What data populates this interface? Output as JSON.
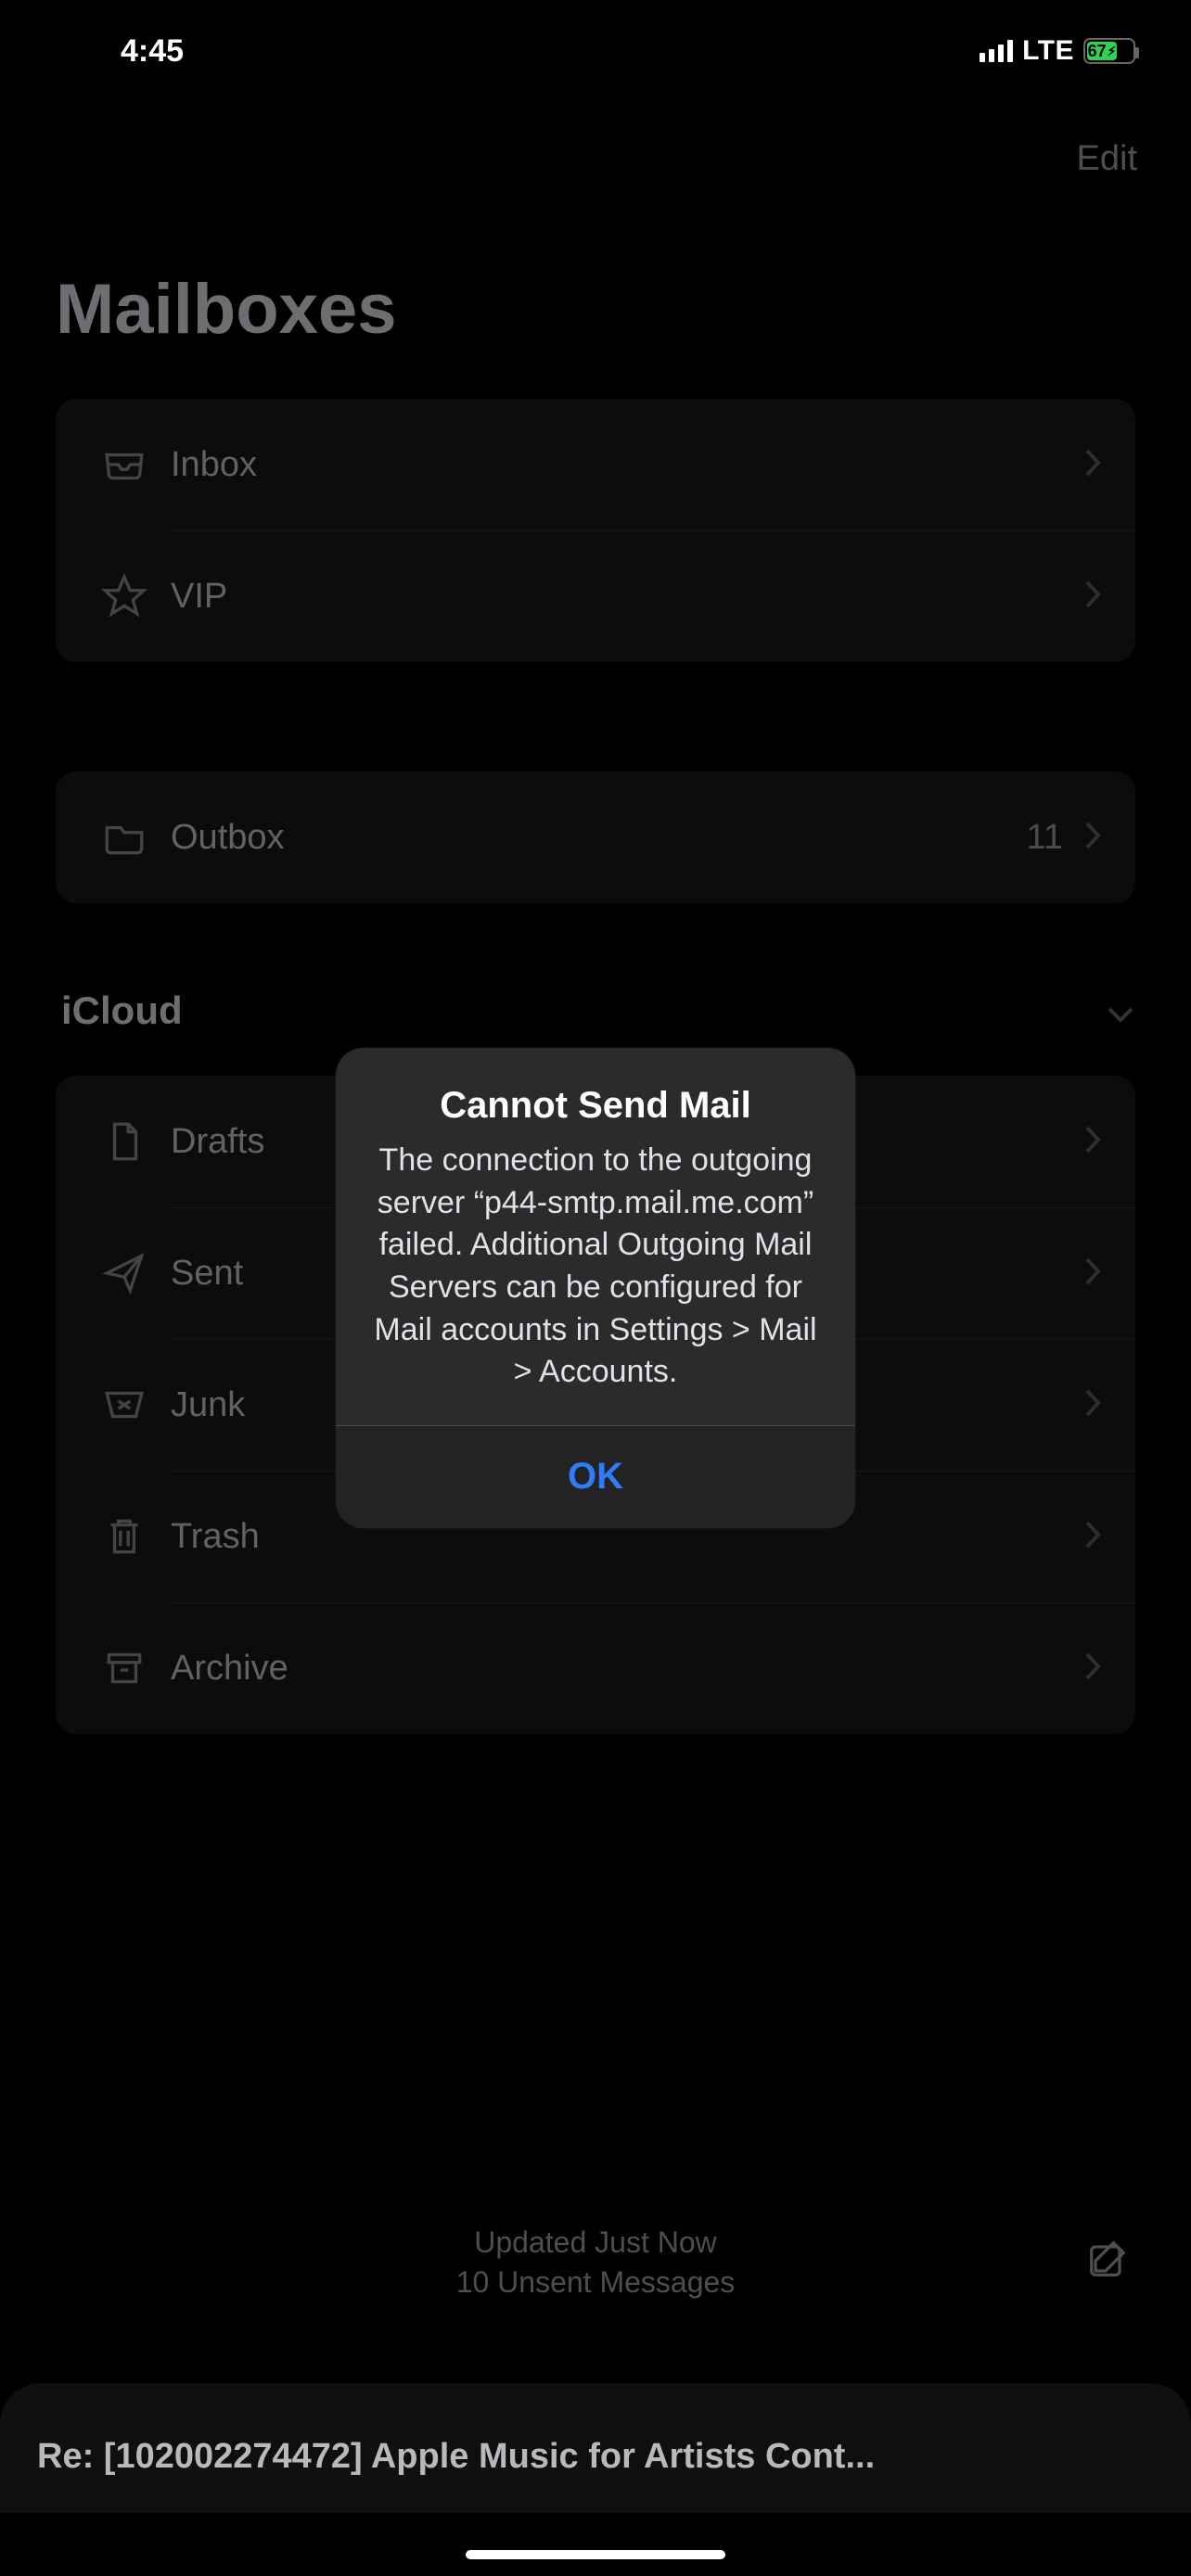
{
  "status": {
    "time": "4:45",
    "network": "LTE",
    "battery_pct": "67",
    "battery_fill_pct": 67
  },
  "nav": {
    "edit": "Edit"
  },
  "title": "Mailboxes",
  "group1": {
    "inbox": "Inbox",
    "vip": "VIP"
  },
  "group2": {
    "outbox": "Outbox",
    "outbox_count": "11"
  },
  "sections": {
    "icloud": "iCloud"
  },
  "group3": {
    "drafts": "Drafts",
    "sent": "Sent",
    "junk": "Junk",
    "trash": "Trash",
    "archive": "Archive"
  },
  "toolbar": {
    "updated": "Updated Just Now",
    "unsent": "10 Unsent Messages"
  },
  "alert": {
    "title": "Cannot Send Mail",
    "message": "The connection to the outgoing server “p44-smtp.mail.me.com” failed. Additional Outgoing Mail Servers can be configured for Mail accounts in Settings > Mail > Accounts.",
    "ok": "OK"
  },
  "banner": {
    "subject": "Re: [102002274472] Apple Music for Artists Cont..."
  }
}
